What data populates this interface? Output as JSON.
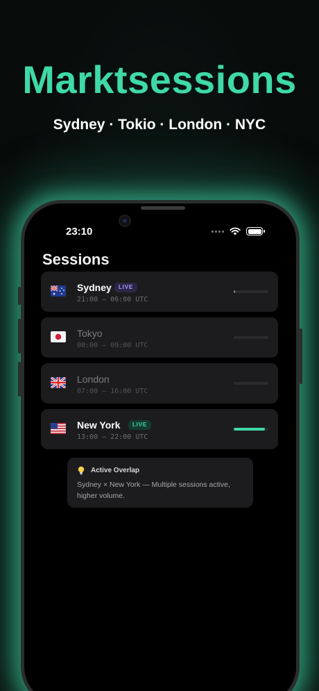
{
  "hero": {
    "title": "Marktsessions",
    "subtitle": "Sydney · Tokio · London · NYC"
  },
  "status_bar": {
    "time": "23:10"
  },
  "screen": {
    "title": "Sessions"
  },
  "sessions": [
    {
      "name": "Sydney",
      "hours": "21:00 — 06:00 UTC",
      "badge": "LIVE",
      "active": true,
      "flag": "australia-flag-icon",
      "progress": 0.03,
      "badge_color": "#7a6be0",
      "bar_color": "#8a8a8a"
    },
    {
      "name": "Tokyo",
      "hours": "00:00 — 09:00 UTC",
      "badge": "",
      "active": false,
      "flag": "japan-flag-icon",
      "progress": 0
    },
    {
      "name": "London",
      "hours": "07:00 — 16:00 UTC",
      "badge": "",
      "active": false,
      "flag": "uk-flag-icon",
      "progress": 0
    },
    {
      "name": "New York",
      "hours": "13:00 — 22:00 UTC",
      "badge": "LIVE",
      "active": true,
      "flag": "usa-flag-icon",
      "progress": 0.9,
      "badge_color": "#3fd9a8",
      "bar_color": "#3fd9a8"
    }
  ],
  "overlap": {
    "icon": "lightbulb-icon",
    "title": "Active Overlap",
    "text": "Sydney × New York — Multiple sessions active, higher volume."
  },
  "colors": {
    "accent": "#3fd9a8",
    "card_bg": "#1c1c1e"
  }
}
